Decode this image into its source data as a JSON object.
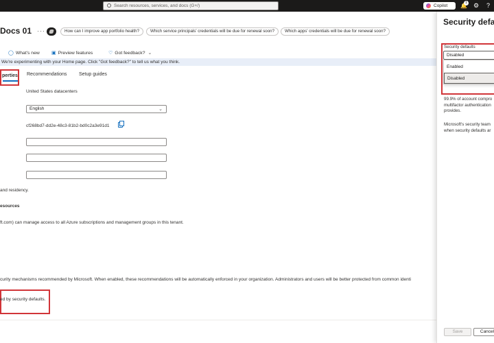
{
  "topbar": {
    "search_placeholder": "Search resources, services, and docs (G+/)",
    "copilot_label": "Copilot",
    "notification_count": "1"
  },
  "header": {
    "title": "Docs 01",
    "chips": [
      "How can I improve app portfolio health?",
      "Which service principals' credentials will be due for renewal soon?",
      "Which apps' credentials will be due for renewal soon?"
    ]
  },
  "cmdbar": {
    "whats_new": "What's new",
    "preview_features": "Preview features",
    "got_feedback": "Got feedback?"
  },
  "info_bar": "We're experimenting with your Home page. Click \"Got feedback?\" to tell us what you think.",
  "tabs": {
    "properties": "perties",
    "recommendations": "Recommendations",
    "setup_guides": "Setup guides"
  },
  "properties": {
    "datacenter": "United States datacenters",
    "language": "English",
    "tenant_id": "cf268bd7-dd2e-48c3-81b2-bd0c2a3e91d1",
    "residency_text": "and residency.",
    "resources_heading": "esources",
    "access_text": "ft.com) can manage access to all Azure subscriptions and management groups in this tenant.",
    "security_text": "curity mechanisms recommended by Microsoft. When enabled, these recommendations will be automatically enforced in your organization. Administrators and users will be better protected from common identi",
    "managed_text": "ed by security defaults."
  },
  "panel": {
    "title": "Security defaults",
    "dropdown_label": "Security defaults",
    "current_value": "Disabled",
    "options": [
      "Enabled",
      "Disabled"
    ],
    "para1": [
      "99.9% of account compro",
      "multifactor authentication",
      "provides."
    ],
    "para2": [
      "Microsoft's security team",
      "when security defaults ar"
    ],
    "save_label": "Save",
    "cancel_label": "Cancel"
  },
  "colors": {
    "accent": "#0f6cbd",
    "highlight_red": "#d13438",
    "topbar": "#1b1a19"
  }
}
